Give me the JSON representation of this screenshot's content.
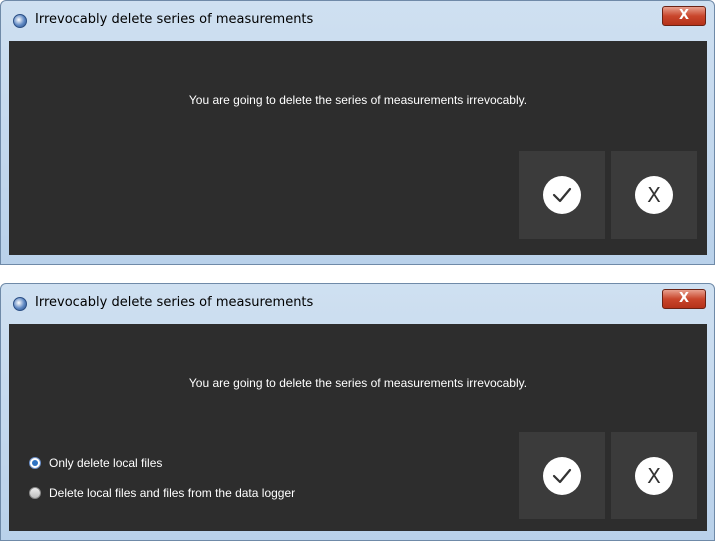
{
  "dialog1": {
    "title": "Irrevocably delete series of measurements",
    "close_label": "X",
    "message": "You are going to delete the series of measurements irrevocably.",
    "cancel_label": "X"
  },
  "dialog2": {
    "title": "Irrevocably delete series of measurements",
    "close_label": "X",
    "message": "You are going to delete the series of measurements irrevocably.",
    "options": [
      {
        "label": "Only delete local files",
        "selected": true
      },
      {
        "label": "Delete local files and files from the data logger",
        "selected": false
      }
    ],
    "cancel_label": "X"
  },
  "colors": {
    "content_bg": "#2d2d2d",
    "button_bg": "#3b3b3b",
    "close_red": "#c9462c",
    "title_bar": "#cfe0f1"
  },
  "icons": {
    "confirm": "checkmark-icon",
    "cancel": "x-icon",
    "app": "pce-logo-icon"
  }
}
